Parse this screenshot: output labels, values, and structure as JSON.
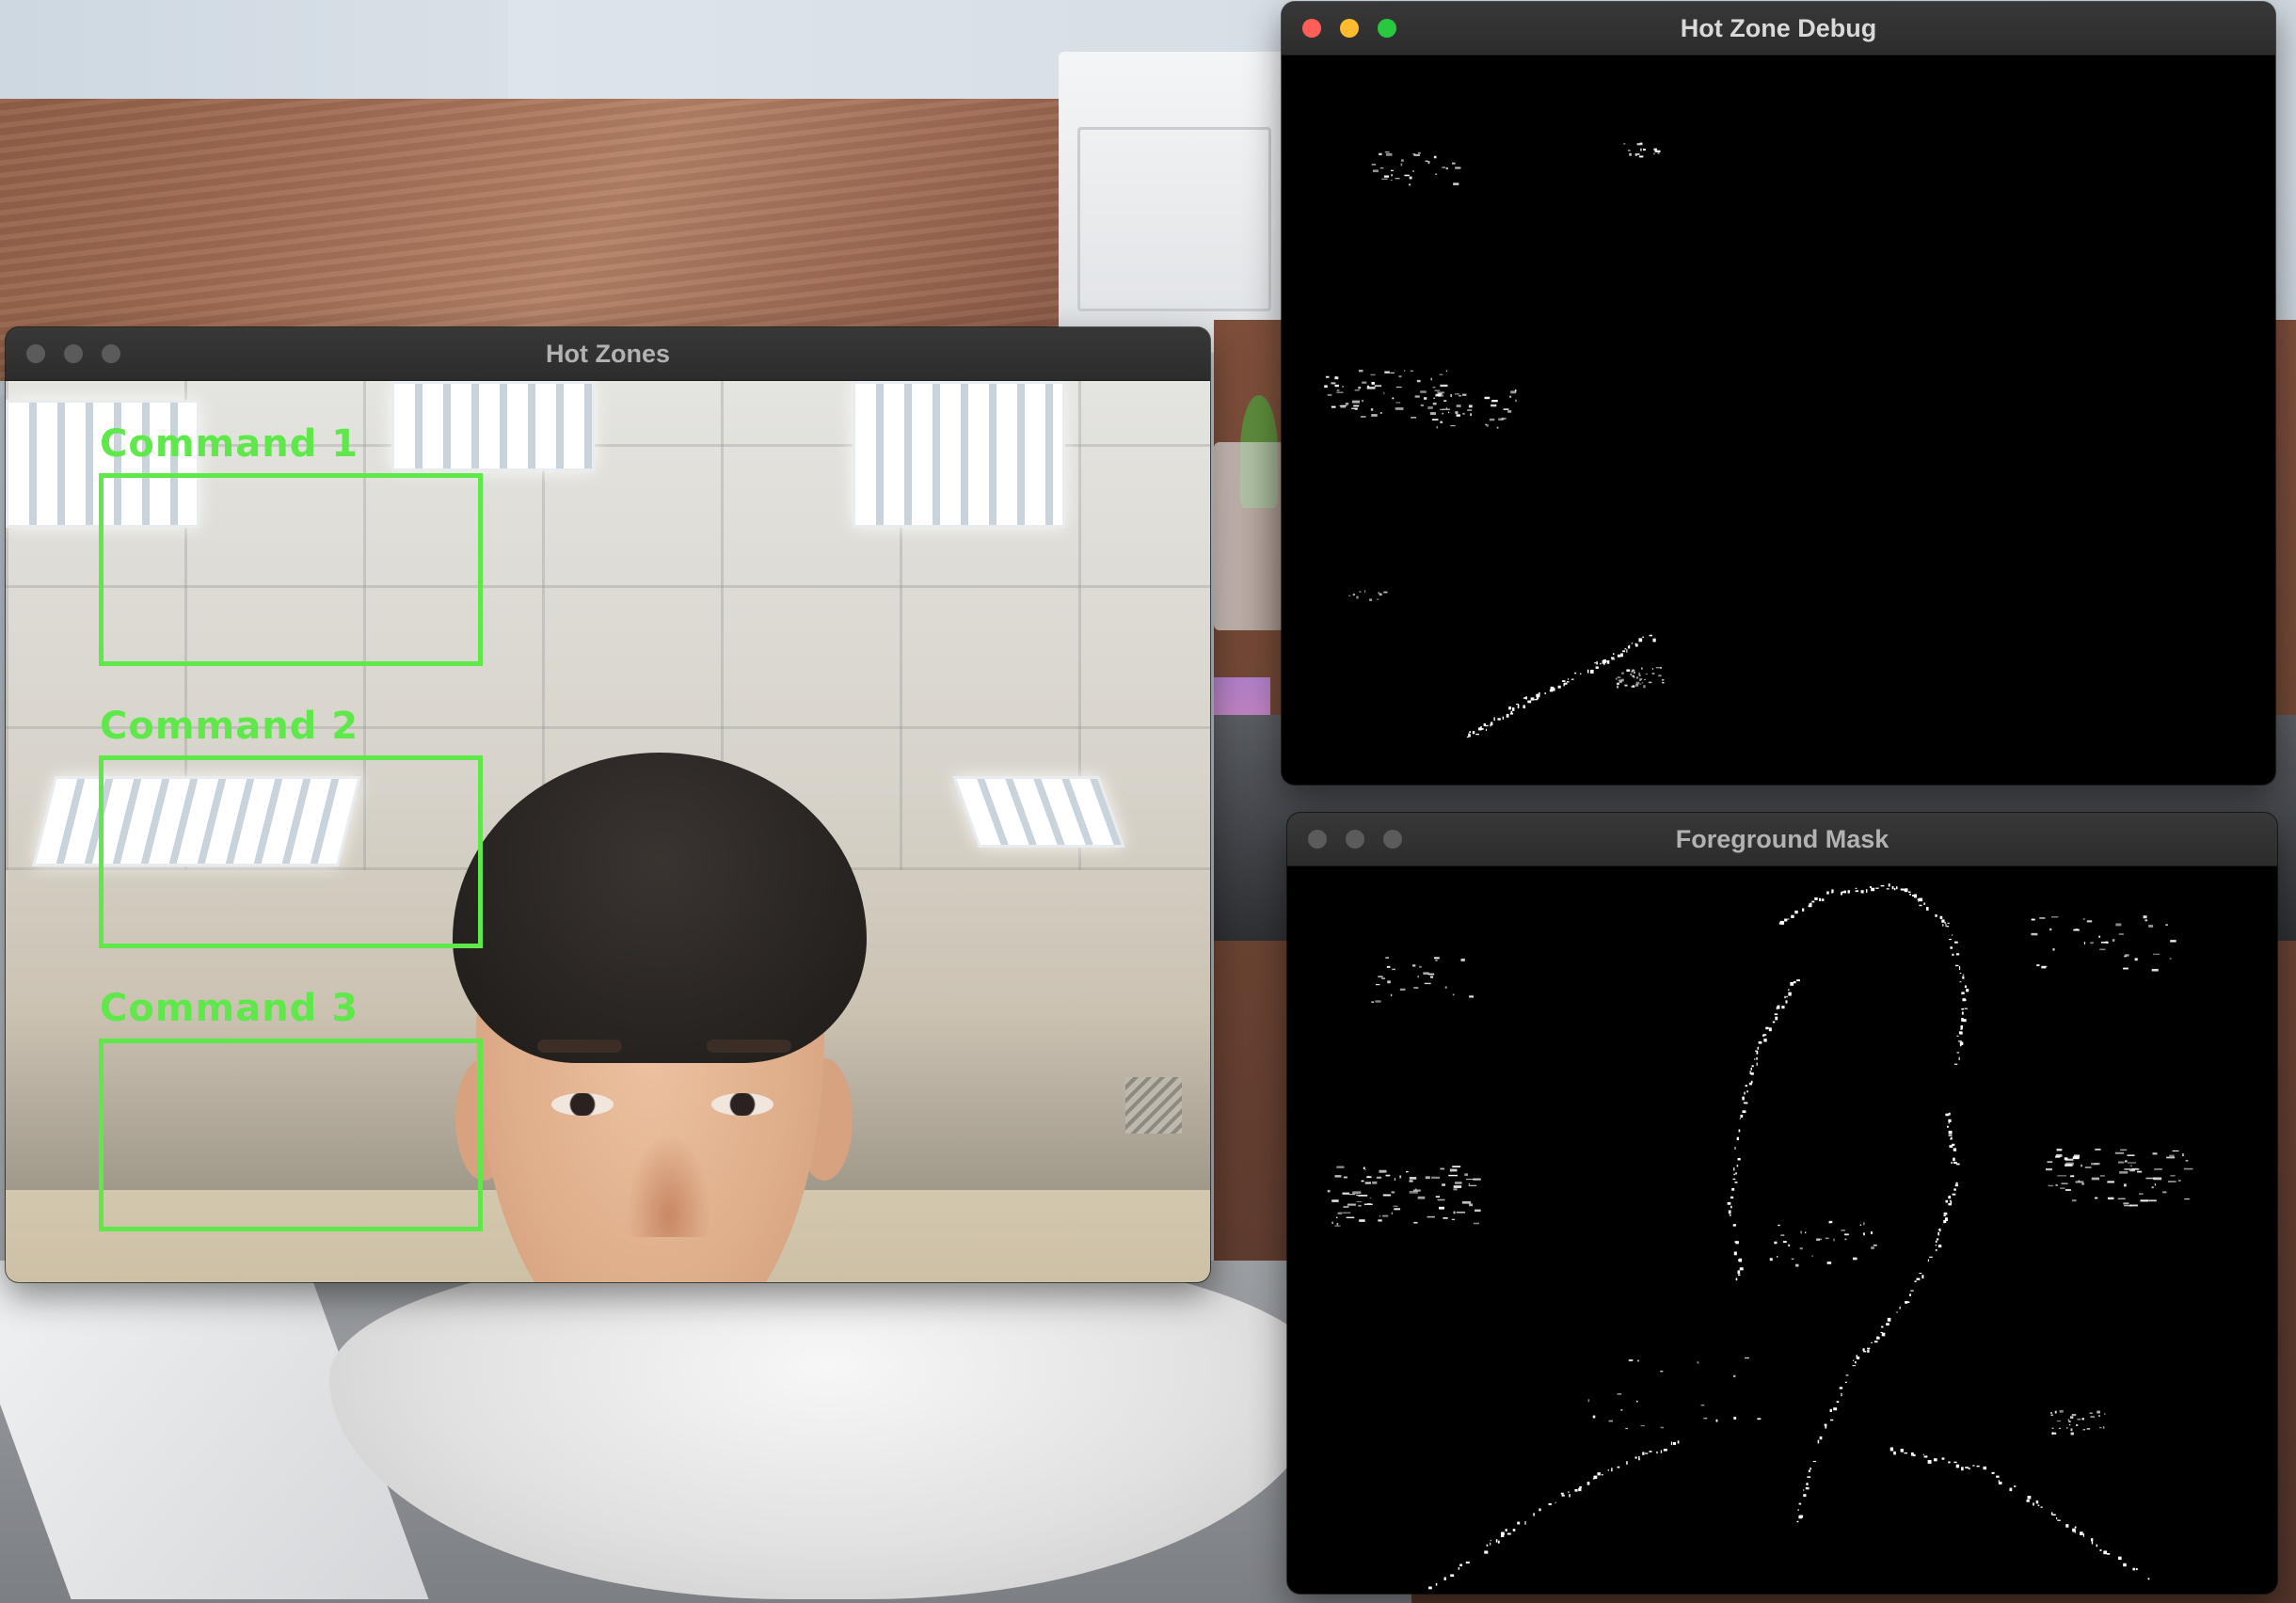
{
  "windows": {
    "hot_zones": {
      "title": "Hot Zones",
      "zones": [
        {
          "label": "Command 1"
        },
        {
          "label": "Command 2"
        },
        {
          "label": "Command 3"
        }
      ]
    },
    "hot_zone_debug": {
      "title": "Hot Zone Debug"
    },
    "foreground_mask": {
      "title": "Foreground Mask"
    }
  },
  "colors": {
    "zone_accent": "#5ee84a",
    "traffic_close": "#ff5f57",
    "traffic_minimize": "#febc2e",
    "traffic_zoom": "#28c840",
    "traffic_inactive": "#5b5b5b"
  },
  "icons": [
    "close-button-icon",
    "minimize-button-icon",
    "zoom-button-icon"
  ]
}
